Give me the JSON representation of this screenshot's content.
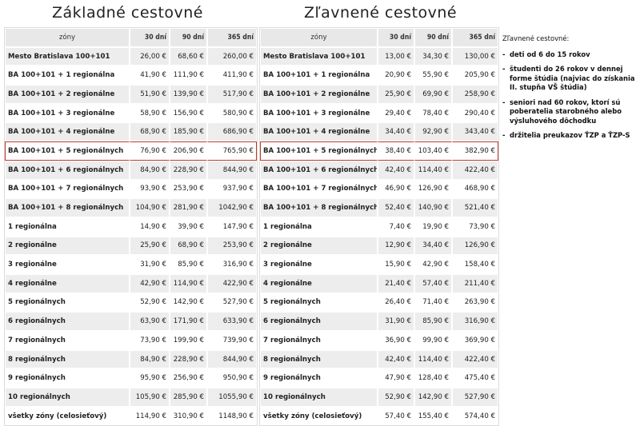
{
  "titles": {
    "basic": "Základné cestovné",
    "discount": "Zľavnené cestovné"
  },
  "headers": {
    "zones": "zóny",
    "d30": "30 dní",
    "d90": "90 dní",
    "d365": "365 dní"
  },
  "basic_rows": [
    {
      "zone": "Mesto Bratislava 100+101",
      "d30": "26,00 €",
      "d90": "68,60 €",
      "d365": "260,00 €"
    },
    {
      "zone": "BA 100+101 + 1 regionálna",
      "d30": "41,90 €",
      "d90": "111,90 €",
      "d365": "411,90 €"
    },
    {
      "zone": "BA 100+101 + 2 regionálne",
      "d30": "51,90 €",
      "d90": "139,90 €",
      "d365": "517,90 €"
    },
    {
      "zone": "BA 100+101 + 3 regionálne",
      "d30": "58,90 €",
      "d90": "156,90 €",
      "d365": "580,90 €"
    },
    {
      "zone": "BA 100+101 + 4 regionálne",
      "d30": "68,90 €",
      "d90": "185,90 €",
      "d365": "686,90 €"
    },
    {
      "zone": "BA 100+101 + 5 regionálnych",
      "d30": "76,90 €",
      "d90": "206,90 €",
      "d365": "765,90 €"
    },
    {
      "zone": "BA 100+101 + 6 regionálnych",
      "d30": "84,90 €",
      "d90": "228,90 €",
      "d365": "844,90 €"
    },
    {
      "zone": "BA 100+101 + 7 regionálnych",
      "d30": "93,90 €",
      "d90": "253,90 €",
      "d365": "937,90 €"
    },
    {
      "zone": "BA 100+101 + 8 regionálnych",
      "d30": "104,90 €",
      "d90": "281,90 €",
      "d365": "1042,90 €"
    },
    {
      "zone": "1 regionálna",
      "d30": "14,90 €",
      "d90": "39,90 €",
      "d365": "147,90 €"
    },
    {
      "zone": "2 regionálne",
      "d30": "25,90 €",
      "d90": "68,90 €",
      "d365": "253,90 €"
    },
    {
      "zone": "3 regionálne",
      "d30": "31,90 €",
      "d90": "85,90 €",
      "d365": "316,90 €"
    },
    {
      "zone": "4 regionálne",
      "d30": "42,90 €",
      "d90": "114,90 €",
      "d365": "422,90 €"
    },
    {
      "zone": "5 regionálnych",
      "d30": "52,90 €",
      "d90": "142,90 €",
      "d365": "527,90 €"
    },
    {
      "zone": "6 regionálnych",
      "d30": "63,90 €",
      "d90": "171,90 €",
      "d365": "633,90 €"
    },
    {
      "zone": "7 regionálnych",
      "d30": "73,90 €",
      "d90": "199,90 €",
      "d365": "739,90 €"
    },
    {
      "zone": "8 regionálnych",
      "d30": "84,90 €",
      "d90": "228,90 €",
      "d365": "844,90 €"
    },
    {
      "zone": "9 regionálnych",
      "d30": "95,90 €",
      "d90": "256,90 €",
      "d365": "950,90 €"
    },
    {
      "zone": "10 regionálnych",
      "d30": "105,90 €",
      "d90": "285,90 €",
      "d365": "1055,90 €"
    },
    {
      "zone": "všetky zóny (celosieťový)",
      "d30": "114,90 €",
      "d90": "310,90 €",
      "d365": "1148,90 €"
    }
  ],
  "discount_rows": [
    {
      "zone": "Mesto Bratislava 100+101",
      "d30": "13,00 €",
      "d90": "34,30 €",
      "d365": "130,00 €"
    },
    {
      "zone": "BA 100+101 + 1 regionálna",
      "d30": "20,90 €",
      "d90": "55,90 €",
      "d365": "205,90 €"
    },
    {
      "zone": "BA 100+101 + 2 regionálne",
      "d30": "25,90 €",
      "d90": "69,90 €",
      "d365": "258,90 €"
    },
    {
      "zone": "BA 100+101 + 3 regionálne",
      "d30": "29,40 €",
      "d90": "78,40 €",
      "d365": "290,40 €"
    },
    {
      "zone": "BA 100+101 + 4 regionálne",
      "d30": "34,40 €",
      "d90": "92,90 €",
      "d365": "343,40 €"
    },
    {
      "zone": "BA 100+101 + 5 regionálnych",
      "d30": "38,40 €",
      "d90": "103,40 €",
      "d365": "382,90 €"
    },
    {
      "zone": "BA 100+101 + 6 regionálnych",
      "d30": "42,40 €",
      "d90": "114,40 €",
      "d365": "422,40 €"
    },
    {
      "zone": "BA 100+101 + 7 regionálnych",
      "d30": "46,90 €",
      "d90": "126,90 €",
      "d365": "468,90 €"
    },
    {
      "zone": "BA 100+101 + 8 regionálnych",
      "d30": "52,40 €",
      "d90": "140,90 €",
      "d365": "521,40 €"
    },
    {
      "zone": "1 regionálna",
      "d30": "7,40 €",
      "d90": "19,90 €",
      "d365": "73,90 €"
    },
    {
      "zone": "2 regionálne",
      "d30": "12,90 €",
      "d90": "34,40 €",
      "d365": "126,90 €"
    },
    {
      "zone": "3 regionálne",
      "d30": "15,90 €",
      "d90": "42,90 €",
      "d365": "158,40 €"
    },
    {
      "zone": "4 regionálne",
      "d30": "21,40 €",
      "d90": "57,40 €",
      "d365": "211,40 €"
    },
    {
      "zone": "5 regionálnych",
      "d30": "26,40 €",
      "d90": "71,40 €",
      "d365": "263,90 €"
    },
    {
      "zone": "6 regionálnych",
      "d30": "31,90 €",
      "d90": "85,90 €",
      "d365": "316,90 €"
    },
    {
      "zone": "7 regionálnych",
      "d30": "36,90 €",
      "d90": "99,90 €",
      "d365": "369,90 €"
    },
    {
      "zone": "8 regionálnych",
      "d30": "42,40 €",
      "d90": "114,40 €",
      "d365": "422,40 €"
    },
    {
      "zone": "9 regionálnych",
      "d30": "47,90 €",
      "d90": "128,40 €",
      "d365": "475,40 €"
    },
    {
      "zone": "10 regionálnych",
      "d30": "52,90 €",
      "d90": "142,90 €",
      "d365": "527,90 €"
    },
    {
      "zone": "všetky zóny (celosieťový)",
      "d30": "57,40 €",
      "d90": "155,40 €",
      "d365": "574,40 €"
    }
  ],
  "highlight_row": 5,
  "highlight_color": "#c0392b",
  "notes": {
    "title": "Zľavnené cestovné:",
    "items": [
      "deti od 6 do 15 rokov",
      "študenti do 26 rokov v dennej forme štúdia (najviac do získania II. stupňa VŠ štúdia)",
      "seniori nad 60 rokov, ktorí sú poberatelia starobného alebo výsluhového dôchodku",
      "držitelia preukazov ŤZP a ŤZP-S"
    ]
  }
}
